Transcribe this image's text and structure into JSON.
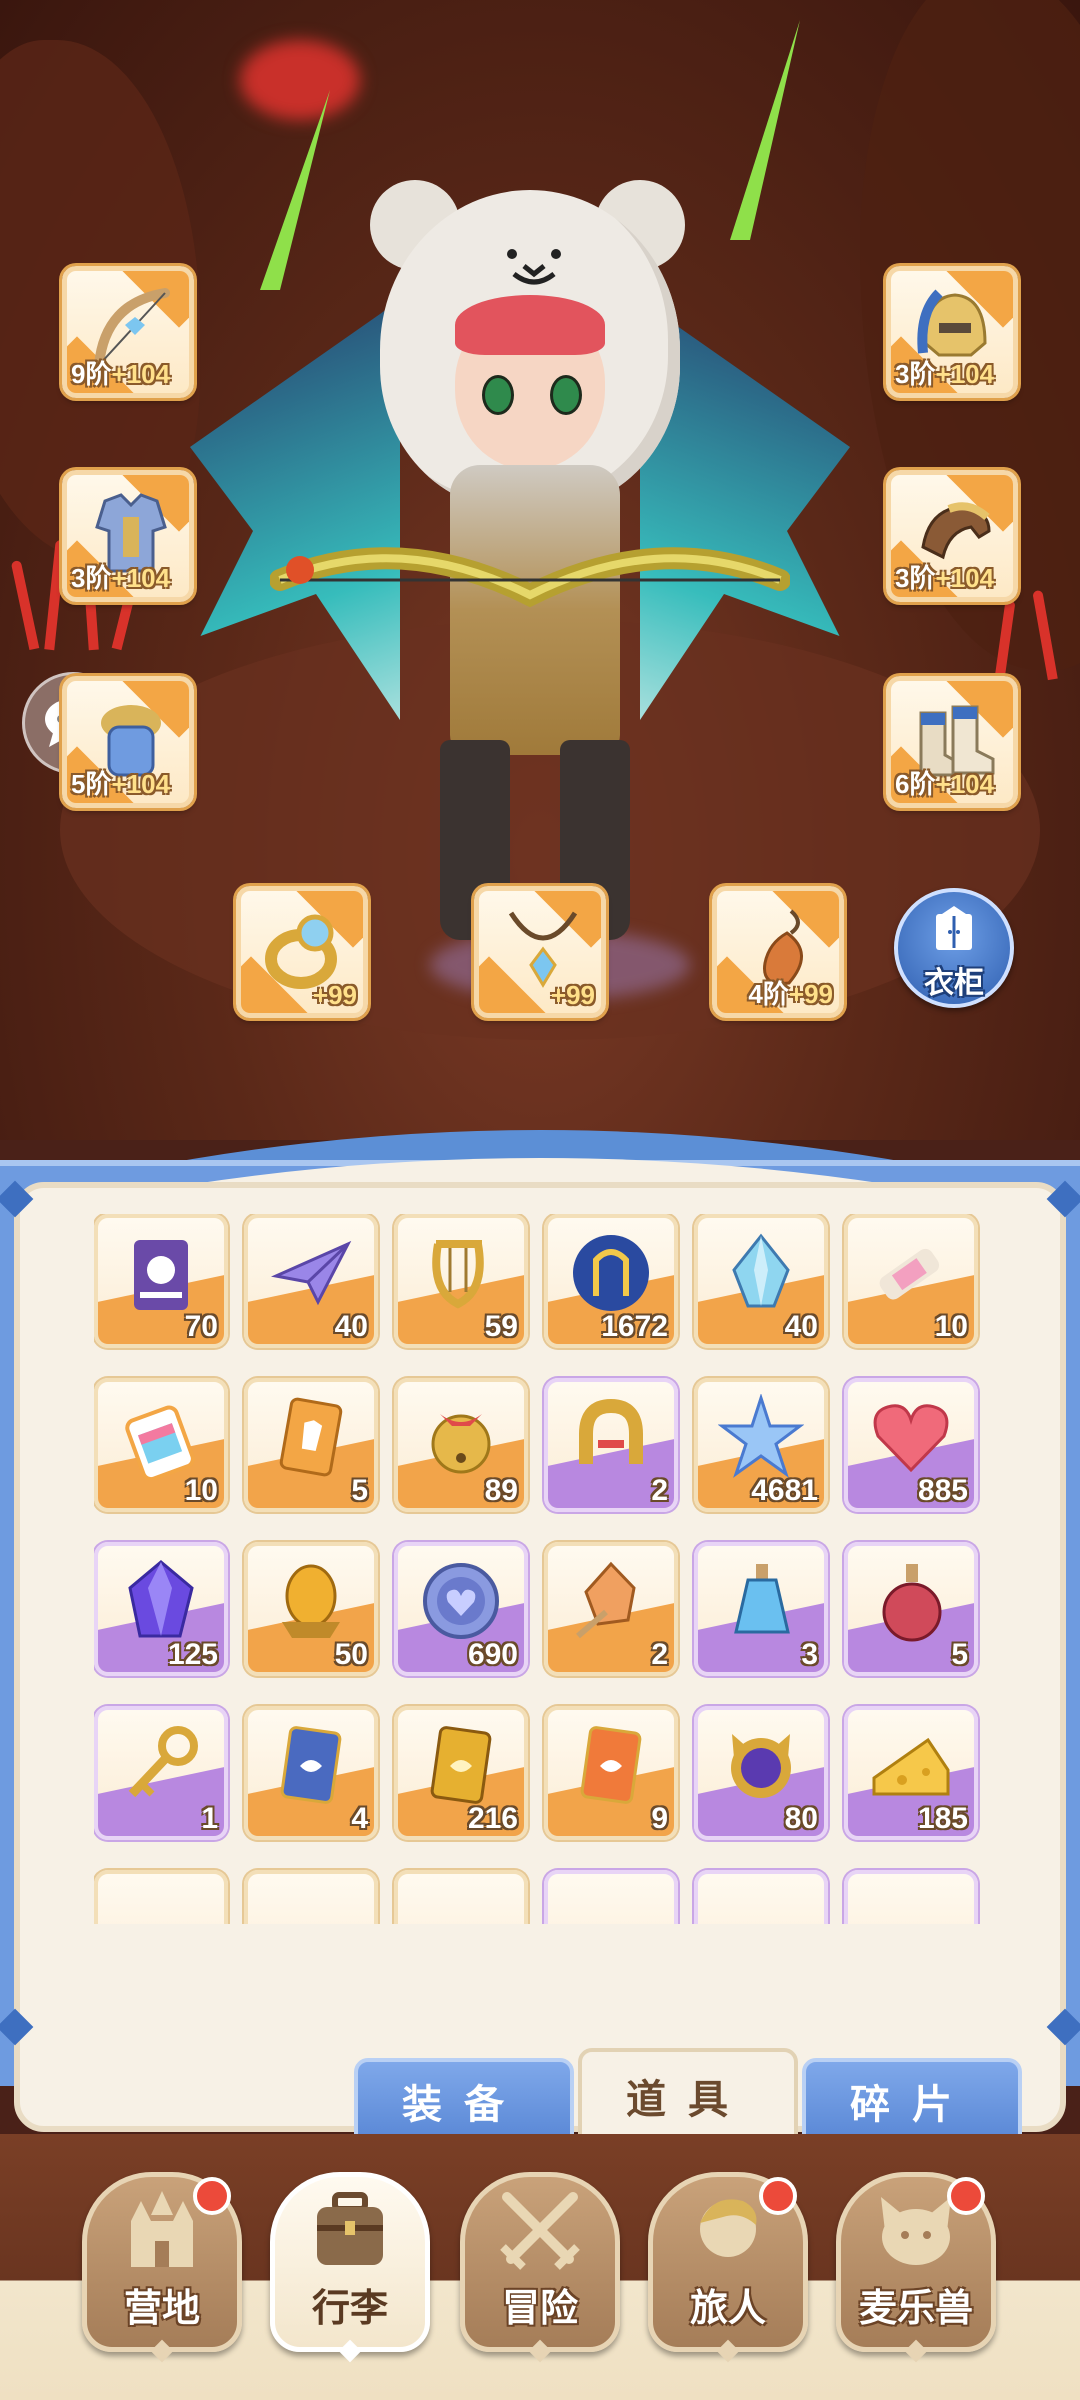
{
  "equipment": {
    "left": [
      {
        "icon": "bow-icon",
        "tier": "9阶",
        "plus": "+104"
      },
      {
        "icon": "chest-armor-icon",
        "tier": "3阶",
        "plus": "+104"
      },
      {
        "icon": "shoulder-armor-icon",
        "tier": "5阶",
        "plus": "+104"
      }
    ],
    "right": [
      {
        "icon": "helmet-icon",
        "tier": "3阶",
        "plus": "+104"
      },
      {
        "icon": "gloves-icon",
        "tier": "3阶",
        "plus": "+104"
      },
      {
        "icon": "boots-icon",
        "tier": "6阶",
        "plus": "+104"
      }
    ],
    "accessories": [
      {
        "icon": "ring-icon",
        "tier": "",
        "plus": "+99"
      },
      {
        "icon": "necklace-icon",
        "tier": "",
        "plus": "+99"
      },
      {
        "icon": "charm-icon",
        "tier": "4阶",
        "plus": "+99"
      }
    ]
  },
  "wardrobe": {
    "label": "衣柜",
    "icon": "wardrobe-icon"
  },
  "chat": {
    "icon": "chat-bubble-icon"
  },
  "inventory": {
    "items": [
      {
        "icon": "ticket-icon",
        "count": "70",
        "rarity": "orange"
      },
      {
        "icon": "paper-plane-icon",
        "count": "40",
        "rarity": "orange"
      },
      {
        "icon": "lyre-icon",
        "count": "59",
        "rarity": "orange"
      },
      {
        "icon": "gate-orb-icon",
        "count": "1672",
        "rarity": "orange"
      },
      {
        "icon": "crystal-icon",
        "count": "40",
        "rarity": "orange"
      },
      {
        "icon": "paint-tube-icon",
        "count": "10",
        "rarity": "orange"
      },
      {
        "icon": "rainbow-paint-icon",
        "count": "10",
        "rarity": "orange"
      },
      {
        "icon": "outfit-card-icon",
        "count": "5",
        "rarity": "orange"
      },
      {
        "icon": "bell-icon",
        "count": "89",
        "rarity": "orange"
      },
      {
        "icon": "horseshoe-icon",
        "count": "2",
        "rarity": "purple"
      },
      {
        "icon": "star-crystal-icon",
        "count": "4681",
        "rarity": "orange"
      },
      {
        "icon": "heart-icon",
        "count": "885",
        "rarity": "purple"
      },
      {
        "icon": "purple-gem-icon",
        "count": "125",
        "rarity": "purple"
      },
      {
        "icon": "amber-egg-icon",
        "count": "50",
        "rarity": "orange"
      },
      {
        "icon": "coin-icon",
        "count": "690",
        "rarity": "purple"
      },
      {
        "icon": "ore-icon",
        "count": "2",
        "rarity": "orange"
      },
      {
        "icon": "blue-potion-icon",
        "count": "3",
        "rarity": "purple"
      },
      {
        "icon": "red-potion-icon",
        "count": "5",
        "rarity": "purple"
      },
      {
        "icon": "key-icon",
        "count": "1",
        "rarity": "purple"
      },
      {
        "icon": "blue-card-icon",
        "count": "4",
        "rarity": "orange"
      },
      {
        "icon": "gold-card-icon",
        "count": "216",
        "rarity": "orange"
      },
      {
        "icon": "orange-card-icon",
        "count": "9",
        "rarity": "orange"
      },
      {
        "icon": "cat-orb-icon",
        "count": "80",
        "rarity": "purple"
      },
      {
        "icon": "cheese-icon",
        "count": "185",
        "rarity": "purple"
      }
    ]
  },
  "tabs": [
    {
      "label": "装备",
      "active": false
    },
    {
      "label": "道具",
      "active": true
    },
    {
      "label": "碎片",
      "active": false
    }
  ],
  "nav": [
    {
      "label": "营地",
      "icon": "castle-icon",
      "badge": true,
      "active": false
    },
    {
      "label": "行李",
      "icon": "luggage-icon",
      "badge": false,
      "active": true
    },
    {
      "label": "冒险",
      "icon": "crossed-swords-icon",
      "badge": false,
      "active": false
    },
    {
      "label": "旅人",
      "icon": "traveler-icon",
      "badge": true,
      "active": false
    },
    {
      "label": "麦乐兽",
      "icon": "cat-beast-icon",
      "badge": true,
      "active": false
    }
  ]
}
